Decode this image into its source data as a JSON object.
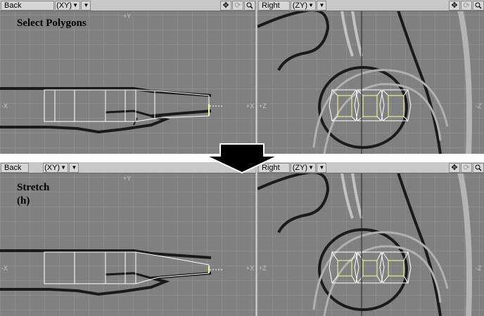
{
  "top": {
    "caption": "Select Polygons",
    "left_view": {
      "view": "Back",
      "projection": "(XY)"
    },
    "right_view": {
      "view": "Right",
      "projection": "(ZY)"
    }
  },
  "bottom": {
    "caption": "Stretch\n(h)",
    "left_view": {
      "view": "Back",
      "projection": "(XY)"
    },
    "right_view": {
      "view": "Right",
      "projection": "(ZY)"
    }
  },
  "axis_labels": {
    "plus_y": "+Y",
    "minus_x": "-X",
    "plus_x": "+X",
    "minus_z": "-Z",
    "plus_z": "+Z"
  },
  "icons": {
    "move": "move-icon",
    "rotate": "rotate-icon",
    "zoom": "magnifier-icon",
    "dropdown": "triangle-down-icon",
    "step_arrow": "down-arrow-icon"
  },
  "colors": {
    "viewport_bg": "#808080",
    "grid": "#8c8c8c",
    "mesh_wire": "#ffffff",
    "selected_poly": "#ffff99",
    "ink": "#1a1a1a"
  }
}
